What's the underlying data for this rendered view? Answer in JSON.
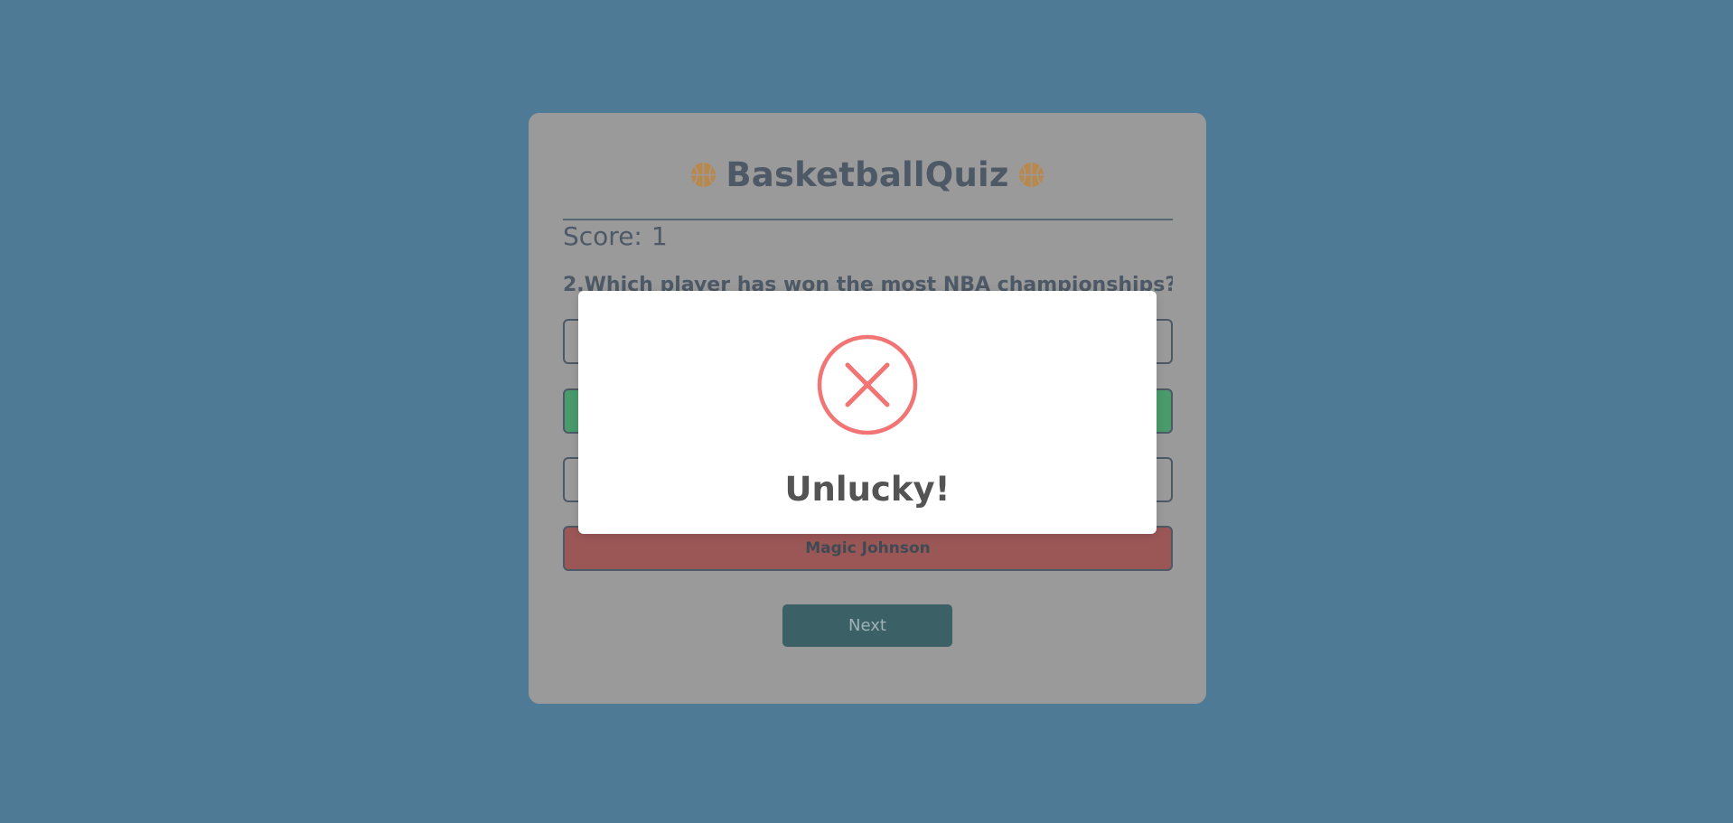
{
  "app": {
    "title": "BasketballQuiz",
    "title_icon": "basketball-icon"
  },
  "score": {
    "label": "Score:",
    "value": "1"
  },
  "question": {
    "text": "2.Which player has won the most NBA championships?"
  },
  "answers": [
    {
      "label": "",
      "state": "neutral"
    },
    {
      "label": "",
      "state": "correct"
    },
    {
      "label": "",
      "state": "neutral"
    },
    {
      "label": "Magic Johnson",
      "state": "wrong"
    }
  ],
  "next_button": {
    "label": "Next"
  },
  "modal": {
    "icon": "error-x-icon",
    "title": "Unlucky!"
  },
  "colors": {
    "background": "#4e7a95",
    "card": "#9a9a9a",
    "correct": "#4a9b6c",
    "wrong": "#9a5756",
    "next": "#3b6166",
    "error": "#f27474"
  }
}
